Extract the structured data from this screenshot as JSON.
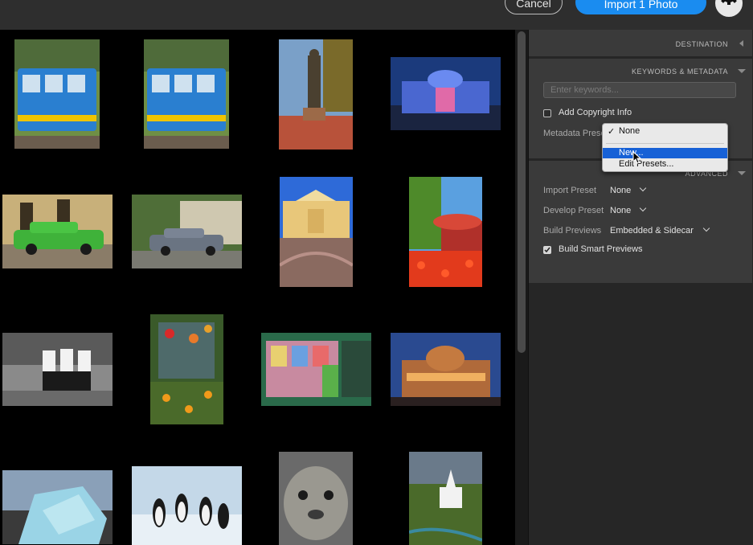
{
  "header": {
    "cancel_label": "Cancel",
    "import_label": "Import 1 Photo"
  },
  "panel": {
    "destination_title": "DESTINATION",
    "keywords_title": "KEYWORDS & METADATA",
    "keywords_placeholder": "Enter keywords...",
    "copyright_label": "Add Copyright Info",
    "metadata_preset_label": "Metadata Preset",
    "advanced_title": "ADVANCED",
    "import_preset_label": "Import Preset",
    "import_preset_value": "None",
    "develop_preset_label": "Develop Preset",
    "develop_preset_value": "None",
    "build_previews_label": "Build Previews",
    "build_previews_value": "Embedded & Sidecar",
    "smart_previews_label": "Build Smart Previews",
    "smart_previews_checked": true
  },
  "dropdown": {
    "checkmark": "✓",
    "items": [
      "None",
      "New...",
      "Edit Presets..."
    ],
    "selected": "None",
    "highlighted": "New..."
  },
  "thumbnails": [
    "blue-tram",
    "blue-tram",
    "statue",
    "opera-house-night",
    "green-car",
    "gray-car",
    "yellow-building",
    "gazebo-tulips",
    "bw-women",
    "flowers-memorial",
    "newsstand",
    "opera-house-dusk",
    "iceberg",
    "penguins",
    "seal",
    "church-hill"
  ],
  "colors": {
    "accent": "#1a8cf0",
    "panel_bg": "#3a3a3a",
    "menu_highlight": "#1761d6"
  }
}
